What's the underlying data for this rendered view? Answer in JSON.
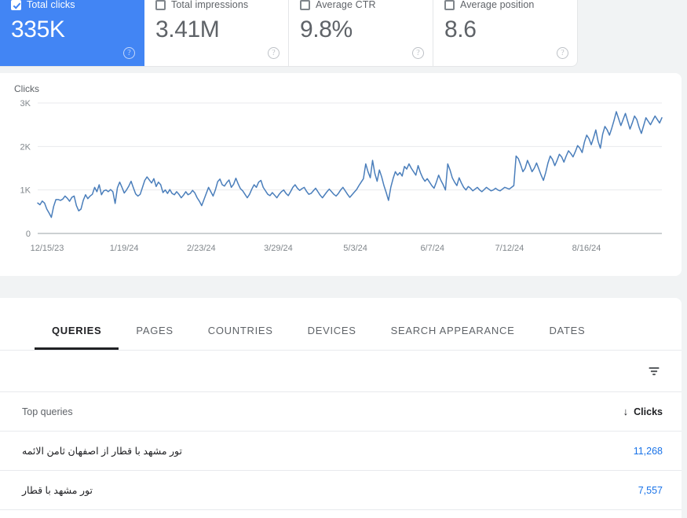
{
  "metrics": [
    {
      "label": "Total clicks",
      "value": "335K",
      "selected": true,
      "help": "?"
    },
    {
      "label": "Total impressions",
      "value": "3.41M",
      "selected": false,
      "help": "?"
    },
    {
      "label": "Average CTR",
      "value": "9.8%",
      "selected": false,
      "help": "?"
    },
    {
      "label": "Average position",
      "value": "8.6",
      "selected": false,
      "help": "?"
    }
  ],
  "chart_data": {
    "type": "line",
    "title": "Clicks",
    "xlabel": "",
    "ylabel": "Clicks",
    "ylim": [
      0,
      3000
    ],
    "yticks": [
      0,
      1000,
      2000,
      3000
    ],
    "ytick_labels": [
      "0",
      "1K",
      "2K",
      "3K"
    ],
    "grid": true,
    "legend": "none",
    "line_color": "#4a7ebb",
    "xtick_labels": [
      "12/15/23",
      "1/19/24",
      "2/23/24",
      "3/29/24",
      "5/3/24",
      "6/7/24",
      "7/12/24",
      "8/16/24"
    ],
    "xtick_positions": [
      0,
      35,
      70,
      105,
      140,
      175,
      210,
      245
    ],
    "x_start": "12/15/23",
    "x_end": "9/14/24",
    "n_points": 275,
    "values": [
      700,
      660,
      745,
      700,
      560,
      470,
      370,
      620,
      780,
      780,
      760,
      790,
      860,
      810,
      740,
      830,
      860,
      640,
      520,
      560,
      760,
      890,
      800,
      860,
      900,
      1060,
      960,
      1120,
      890,
      980,
      1000,
      960,
      1010,
      960,
      690,
      1050,
      1180,
      1060,
      930,
      1000,
      1090,
      1200,
      1050,
      910,
      860,
      900,
      1060,
      1220,
      1300,
      1230,
      1160,
      1260,
      1080,
      1180,
      1120,
      940,
      1000,
      920,
      1010,
      920,
      890,
      960,
      900,
      820,
      880,
      960,
      890,
      920,
      990,
      930,
      820,
      740,
      640,
      780,
      920,
      1060,
      960,
      860,
      1000,
      1190,
      1250,
      1120,
      1090,
      1170,
      1230,
      1060,
      1130,
      1270,
      1140,
      1030,
      980,
      900,
      820,
      900,
      1020,
      1120,
      1060,
      1180,
      1220,
      1060,
      980,
      900,
      870,
      940,
      880,
      820,
      900,
      960,
      1000,
      920,
      870,
      960,
      1060,
      1120,
      1040,
      990,
      1030,
      1060,
      970,
      900,
      920,
      980,
      1040,
      960,
      880,
      820,
      890,
      960,
      1020,
      960,
      900,
      860,
      920,
      1000,
      1060,
      980,
      900,
      830,
      890,
      950,
      1010,
      1100,
      1180,
      1260,
      1600,
      1420,
      1280,
      1680,
      1380,
      1200,
      1460,
      1300,
      1100,
      940,
      760,
      1060,
      1260,
      1420,
      1340,
      1400,
      1320,
      1540,
      1480,
      1600,
      1500,
      1420,
      1340,
      1560,
      1400,
      1280,
      1200,
      1260,
      1180,
      1100,
      1040,
      1180,
      1340,
      1220,
      1120,
      1000,
      1600,
      1460,
      1280,
      1180,
      1100,
      1280,
      1160,
      1060,
      1000,
      1080,
      1040,
      980,
      1020,
      1060,
      1000,
      960,
      1010,
      1060,
      1020,
      980,
      1000,
      1040,
      1000,
      980,
      1020,
      1060,
      1040,
      1020,
      1060,
      1100,
      1780,
      1720,
      1580,
      1420,
      1500,
      1680,
      1560,
      1420,
      1500,
      1620,
      1480,
      1340,
      1220,
      1400,
      1620,
      1780,
      1700,
      1560,
      1680,
      1820,
      1760,
      1640,
      1780,
      1900,
      1840,
      1760,
      1880,
      2020,
      1960,
      1860,
      2100,
      2260,
      2180,
      2040,
      2200,
      2380,
      2120,
      1960,
      2280,
      2460,
      2380,
      2260,
      2420,
      2600,
      2800,
      2640,
      2480,
      2620,
      2760,
      2580,
      2400,
      2540,
      2700,
      2620,
      2440,
      2300,
      2480,
      2660,
      2580,
      2500,
      2600,
      2700,
      2620,
      2540,
      2660
    ]
  },
  "tabs": [
    {
      "label": "QUERIES",
      "active": true
    },
    {
      "label": "PAGES",
      "active": false
    },
    {
      "label": "COUNTRIES",
      "active": false
    },
    {
      "label": "DEVICES",
      "active": false
    },
    {
      "label": "SEARCH APPEARANCE",
      "active": false
    },
    {
      "label": "DATES",
      "active": false
    }
  ],
  "toolbar": {
    "filter_icon": "filter-icon"
  },
  "table": {
    "header_left": "Top queries",
    "header_right": "Clicks",
    "sort_arrow": "↓",
    "rows": [
      {
        "query": "تور مشهد با قطار از اصفهان ثامن الائمه",
        "clicks": "11,268"
      },
      {
        "query": "تور مشهد با قطار",
        "clicks": "7,557"
      }
    ]
  },
  "colors": {
    "accent_blue": "#4285f4",
    "link_blue": "#1a73e8",
    "line_blue": "#4a7ebb",
    "page_bg": "#f1f3f4",
    "text_secondary": "#5f6368"
  }
}
